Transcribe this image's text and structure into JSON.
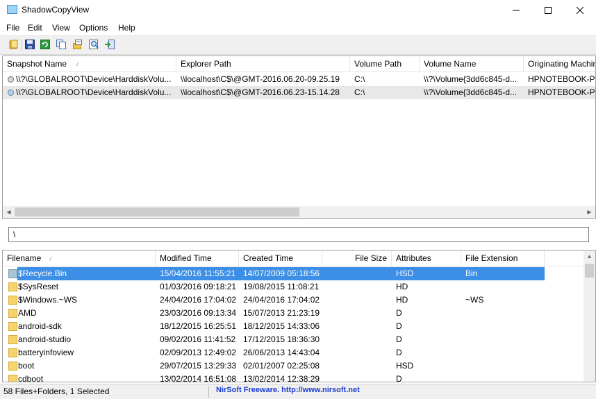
{
  "window": {
    "title": "ShadowCopyView"
  },
  "menu": [
    "File",
    "Edit",
    "View",
    "Options",
    "Help"
  ],
  "toolbar": {
    "buttons": [
      "folder-open-icon",
      "save-icon",
      "refresh-icon",
      "copy-icon",
      "properties-icon",
      "find-icon",
      "exit-icon"
    ]
  },
  "snapshots": {
    "columns": [
      "Snapshot Name",
      "Explorer Path",
      "Volume Path",
      "Volume Name",
      "Originating Machine"
    ],
    "rows": [
      [
        "\\\\?\\GLOBALROOT\\Device\\HarddiskVolu...",
        "\\\\localhost\\C$\\@GMT-2016.06.20-09.25.19",
        "C:\\",
        "\\\\?\\Volume{3dd6c845-d...",
        "HPNOTEBOOK-PC"
      ],
      [
        "\\\\?\\GLOBALROOT\\Device\\HarddiskVolu...",
        "\\\\localhost\\C$\\@GMT-2016.06.23-15.14.28",
        "C:\\",
        "\\\\?\\Volume{3dd6c845-d...",
        "HPNOTEBOOK-PC"
      ]
    ]
  },
  "path": {
    "value": "\\"
  },
  "files": {
    "columns": [
      "Filename",
      "Modified Time",
      "Created Time",
      "File Size",
      "Attributes",
      "File Extension"
    ],
    "rows": [
      [
        "$Recycle.Bin",
        "15/04/2016 11:55:21",
        "14/07/2009 05:18:56",
        "",
        "HSD",
        "Bin"
      ],
      [
        "$SysReset",
        "01/03/2016 09:18:21",
        "19/08/2015 11:08:21",
        "",
        "HD",
        ""
      ],
      [
        "$Windows.~WS",
        "24/04/2016 17:04:02",
        "24/04/2016 17:04:02",
        "",
        "HD",
        "~WS"
      ],
      [
        "AMD",
        "23/03/2016 09:13:34",
        "15/07/2013 21:23:19",
        "",
        "D",
        ""
      ],
      [
        "android-sdk",
        "18/12/2015 16:25:51",
        "18/12/2015 14:33:06",
        "",
        "D",
        ""
      ],
      [
        "android-studio",
        "09/02/2016 11:41:52",
        "17/12/2015 18:36:30",
        "",
        "D",
        ""
      ],
      [
        "batteryinfoview",
        "02/09/2013 12:49:02",
        "26/06/2013 14:43:04",
        "",
        "D",
        ""
      ],
      [
        "boot",
        "29/07/2015 13:29:33",
        "02/01/2007 02:25:08",
        "",
        "HSD",
        ""
      ],
      [
        "cdboot",
        "13/02/2014 16:51:08",
        "13/02/2014 12:38:29",
        "",
        "D",
        ""
      ]
    ]
  },
  "status": {
    "count": "58 Files+Folders, 1 Selected",
    "link": "NirSoft Freeware.  http://www.nirsoft.net"
  },
  "colors": {
    "selection": "#3c8ee6",
    "selection_text": "#ffffff",
    "link": "#1a3bd0",
    "row_alt": "#e8e8e8"
  }
}
